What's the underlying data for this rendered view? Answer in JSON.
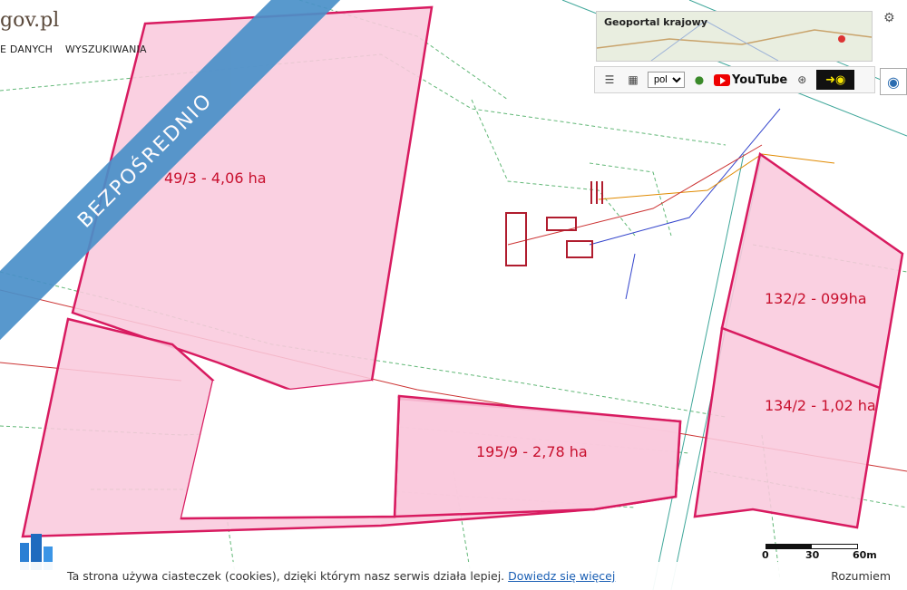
{
  "site": {
    "title": "gov.pl"
  },
  "nav": {
    "items": [
      "E DANYCH",
      "WYSZUKIWANIA"
    ]
  },
  "ribbon": {
    "text": "BEZPOŚREDNIO"
  },
  "parcels": [
    {
      "id": "p493",
      "label": "49/3 - 4,06 ha"
    },
    {
      "id": "p1959",
      "label": "195/9 - 2,78 ha"
    },
    {
      "id": "p1322",
      "label": "132/2 - 099ha"
    },
    {
      "id": "p1342",
      "label": "134/2 - 1,02 ha"
    }
  ],
  "geoportal": {
    "title": "Geoportal krajowy"
  },
  "toolbar": {
    "language": "pol",
    "youtube": "YouTube"
  },
  "scale": {
    "labels": [
      "0",
      "30",
      "60m"
    ]
  },
  "cookie": {
    "message": "Ta strona używa ciasteczek (cookies), dzięki którym nasz serwis działa lepiej.",
    "link": "Dowiedz się więcej",
    "accept": "Rozumiem"
  },
  "colors": {
    "parcel_fill": "#f9c9dd",
    "parcel_stroke": "#d81b60",
    "ribbon": "#4a90c9",
    "label": "#c8102e"
  },
  "icons": [
    "gear-icon",
    "list-icon",
    "wms-icon",
    "help-icon",
    "youtube-icon",
    "wheel-icon",
    "eye-icon"
  ]
}
